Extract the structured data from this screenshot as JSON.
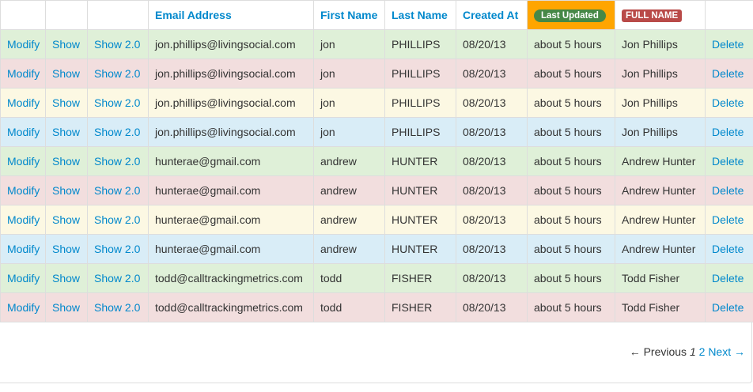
{
  "headers": {
    "email": "Email Address",
    "first": "First Name",
    "last": "Last Name",
    "created": "Created At",
    "updated": "Last Updated",
    "full": "FULL NAME"
  },
  "actions": {
    "modify": "Modify",
    "show": "Show",
    "show2": "Show 2.0",
    "delete": "Delete"
  },
  "rows": [
    {
      "style": "success",
      "email": "jon.phillips@livingsocial.com",
      "first": "jon",
      "last": "PHILLIPS",
      "created": "08/20/13",
      "updated": "about 5 hours",
      "full": "Jon Phillips"
    },
    {
      "style": "error",
      "email": "jon.phillips@livingsocial.com",
      "first": "jon",
      "last": "PHILLIPS",
      "created": "08/20/13",
      "updated": "about 5 hours",
      "full": "Jon Phillips"
    },
    {
      "style": "warning",
      "email": "jon.phillips@livingsocial.com",
      "first": "jon",
      "last": "PHILLIPS",
      "created": "08/20/13",
      "updated": "about 5 hours",
      "full": "Jon Phillips"
    },
    {
      "style": "info",
      "email": "jon.phillips@livingsocial.com",
      "first": "jon",
      "last": "PHILLIPS",
      "created": "08/20/13",
      "updated": "about 5 hours",
      "full": "Jon Phillips"
    },
    {
      "style": "success",
      "email": "hunterae@gmail.com",
      "first": "andrew",
      "last": "HUNTER",
      "created": "08/20/13",
      "updated": "about 5 hours",
      "full": "Andrew Hunter"
    },
    {
      "style": "error",
      "email": "hunterae@gmail.com",
      "first": "andrew",
      "last": "HUNTER",
      "created": "08/20/13",
      "updated": "about 5 hours",
      "full": "Andrew Hunter"
    },
    {
      "style": "warning",
      "email": "hunterae@gmail.com",
      "first": "andrew",
      "last": "HUNTER",
      "created": "08/20/13",
      "updated": "about 5 hours",
      "full": "Andrew Hunter"
    },
    {
      "style": "info",
      "email": "hunterae@gmail.com",
      "first": "andrew",
      "last": "HUNTER",
      "created": "08/20/13",
      "updated": "about 5 hours",
      "full": "Andrew Hunter"
    },
    {
      "style": "success",
      "email": "todd@calltrackingmetrics.com",
      "first": "todd",
      "last": "FISHER",
      "created": "08/20/13",
      "updated": "about 5 hours",
      "full": "Todd Fisher"
    },
    {
      "style": "error",
      "email": "todd@calltrackingmetrics.com",
      "first": "todd",
      "last": "FISHER",
      "created": "08/20/13",
      "updated": "about 5 hours",
      "full": "Todd Fisher"
    }
  ],
  "pagination": {
    "previous": "← Previous",
    "current": "1",
    "page2": "2",
    "next": "Next →"
  }
}
